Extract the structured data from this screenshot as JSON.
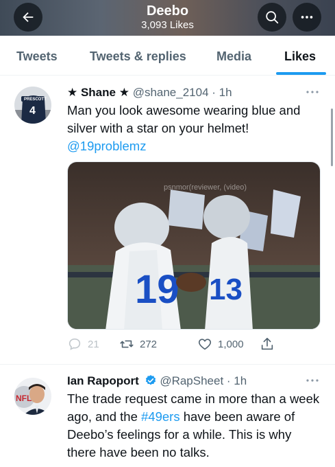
{
  "header": {
    "title": "Deebo",
    "subtitle": "3,093 Likes",
    "back_icon": "arrow-left-icon",
    "search_icon": "search-icon",
    "more_icon": "more-horizontal-icon"
  },
  "tabs": [
    {
      "label": "Tweets",
      "active": false
    },
    {
      "label": "Tweets & replies",
      "active": false
    },
    {
      "label": "Media",
      "active": false
    },
    {
      "label": "Likes",
      "active": true
    }
  ],
  "colors": {
    "accent": "#1d9bf0",
    "text": "#0f1419",
    "muted": "#536471"
  },
  "tweets": [
    {
      "name": "★ Shane ★",
      "handle": "@shane_2104",
      "time": "· 1h",
      "text": "Man you look awesome wearing blue and silver with a star on your helmet!",
      "mention": "@19problemz",
      "media_watermark": "psnmor(reviewer, (video)",
      "jersey_numbers": [
        "19",
        "13"
      ],
      "replies": "21",
      "retweets": "272",
      "likes": "1,000"
    },
    {
      "name": "Ian Rapoport",
      "handle": "@RapSheet",
      "time": "· 1h",
      "text_before": "The trade request came in more than a week ago, and the ",
      "hashtag": "#49ers",
      "text_after": " have been aware of Deebo’s feelings for a while. This is why there have been no talks."
    }
  ]
}
